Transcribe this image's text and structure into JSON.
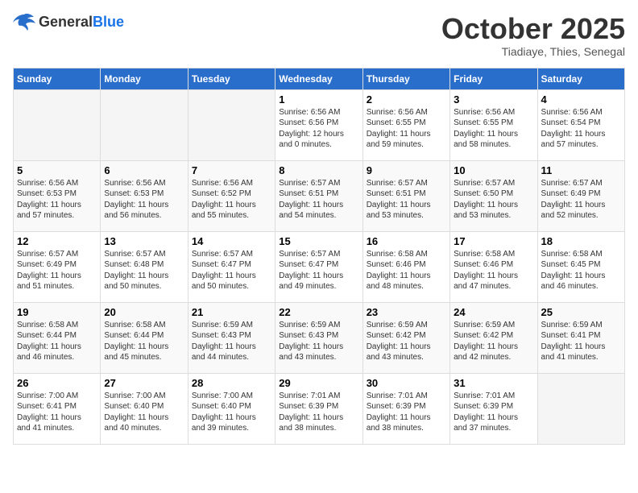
{
  "header": {
    "logo_general": "General",
    "logo_blue": "Blue",
    "month_title": "October 2025",
    "subtitle": "Tiadiaye, Thies, Senegal"
  },
  "weekdays": [
    "Sunday",
    "Monday",
    "Tuesday",
    "Wednesday",
    "Thursday",
    "Friday",
    "Saturday"
  ],
  "weeks": [
    [
      {
        "day": "",
        "info": ""
      },
      {
        "day": "",
        "info": ""
      },
      {
        "day": "",
        "info": ""
      },
      {
        "day": "1",
        "info": "Sunrise: 6:56 AM\nSunset: 6:56 PM\nDaylight: 12 hours\nand 0 minutes."
      },
      {
        "day": "2",
        "info": "Sunrise: 6:56 AM\nSunset: 6:55 PM\nDaylight: 11 hours\nand 59 minutes."
      },
      {
        "day": "3",
        "info": "Sunrise: 6:56 AM\nSunset: 6:55 PM\nDaylight: 11 hours\nand 58 minutes."
      },
      {
        "day": "4",
        "info": "Sunrise: 6:56 AM\nSunset: 6:54 PM\nDaylight: 11 hours\nand 57 minutes."
      }
    ],
    [
      {
        "day": "5",
        "info": "Sunrise: 6:56 AM\nSunset: 6:53 PM\nDaylight: 11 hours\nand 57 minutes."
      },
      {
        "day": "6",
        "info": "Sunrise: 6:56 AM\nSunset: 6:53 PM\nDaylight: 11 hours\nand 56 minutes."
      },
      {
        "day": "7",
        "info": "Sunrise: 6:56 AM\nSunset: 6:52 PM\nDaylight: 11 hours\nand 55 minutes."
      },
      {
        "day": "8",
        "info": "Sunrise: 6:57 AM\nSunset: 6:51 PM\nDaylight: 11 hours\nand 54 minutes."
      },
      {
        "day": "9",
        "info": "Sunrise: 6:57 AM\nSunset: 6:51 PM\nDaylight: 11 hours\nand 53 minutes."
      },
      {
        "day": "10",
        "info": "Sunrise: 6:57 AM\nSunset: 6:50 PM\nDaylight: 11 hours\nand 53 minutes."
      },
      {
        "day": "11",
        "info": "Sunrise: 6:57 AM\nSunset: 6:49 PM\nDaylight: 11 hours\nand 52 minutes."
      }
    ],
    [
      {
        "day": "12",
        "info": "Sunrise: 6:57 AM\nSunset: 6:49 PM\nDaylight: 11 hours\nand 51 minutes."
      },
      {
        "day": "13",
        "info": "Sunrise: 6:57 AM\nSunset: 6:48 PM\nDaylight: 11 hours\nand 50 minutes."
      },
      {
        "day": "14",
        "info": "Sunrise: 6:57 AM\nSunset: 6:47 PM\nDaylight: 11 hours\nand 50 minutes."
      },
      {
        "day": "15",
        "info": "Sunrise: 6:57 AM\nSunset: 6:47 PM\nDaylight: 11 hours\nand 49 minutes."
      },
      {
        "day": "16",
        "info": "Sunrise: 6:58 AM\nSunset: 6:46 PM\nDaylight: 11 hours\nand 48 minutes."
      },
      {
        "day": "17",
        "info": "Sunrise: 6:58 AM\nSunset: 6:46 PM\nDaylight: 11 hours\nand 47 minutes."
      },
      {
        "day": "18",
        "info": "Sunrise: 6:58 AM\nSunset: 6:45 PM\nDaylight: 11 hours\nand 46 minutes."
      }
    ],
    [
      {
        "day": "19",
        "info": "Sunrise: 6:58 AM\nSunset: 6:44 PM\nDaylight: 11 hours\nand 46 minutes."
      },
      {
        "day": "20",
        "info": "Sunrise: 6:58 AM\nSunset: 6:44 PM\nDaylight: 11 hours\nand 45 minutes."
      },
      {
        "day": "21",
        "info": "Sunrise: 6:59 AM\nSunset: 6:43 PM\nDaylight: 11 hours\nand 44 minutes."
      },
      {
        "day": "22",
        "info": "Sunrise: 6:59 AM\nSunset: 6:43 PM\nDaylight: 11 hours\nand 43 minutes."
      },
      {
        "day": "23",
        "info": "Sunrise: 6:59 AM\nSunset: 6:42 PM\nDaylight: 11 hours\nand 43 minutes."
      },
      {
        "day": "24",
        "info": "Sunrise: 6:59 AM\nSunset: 6:42 PM\nDaylight: 11 hours\nand 42 minutes."
      },
      {
        "day": "25",
        "info": "Sunrise: 6:59 AM\nSunset: 6:41 PM\nDaylight: 11 hours\nand 41 minutes."
      }
    ],
    [
      {
        "day": "26",
        "info": "Sunrise: 7:00 AM\nSunset: 6:41 PM\nDaylight: 11 hours\nand 41 minutes."
      },
      {
        "day": "27",
        "info": "Sunrise: 7:00 AM\nSunset: 6:40 PM\nDaylight: 11 hours\nand 40 minutes."
      },
      {
        "day": "28",
        "info": "Sunrise: 7:00 AM\nSunset: 6:40 PM\nDaylight: 11 hours\nand 39 minutes."
      },
      {
        "day": "29",
        "info": "Sunrise: 7:01 AM\nSunset: 6:39 PM\nDaylight: 11 hours\nand 38 minutes."
      },
      {
        "day": "30",
        "info": "Sunrise: 7:01 AM\nSunset: 6:39 PM\nDaylight: 11 hours\nand 38 minutes."
      },
      {
        "day": "31",
        "info": "Sunrise: 7:01 AM\nSunset: 6:39 PM\nDaylight: 11 hours\nand 37 minutes."
      },
      {
        "day": "",
        "info": ""
      }
    ]
  ]
}
